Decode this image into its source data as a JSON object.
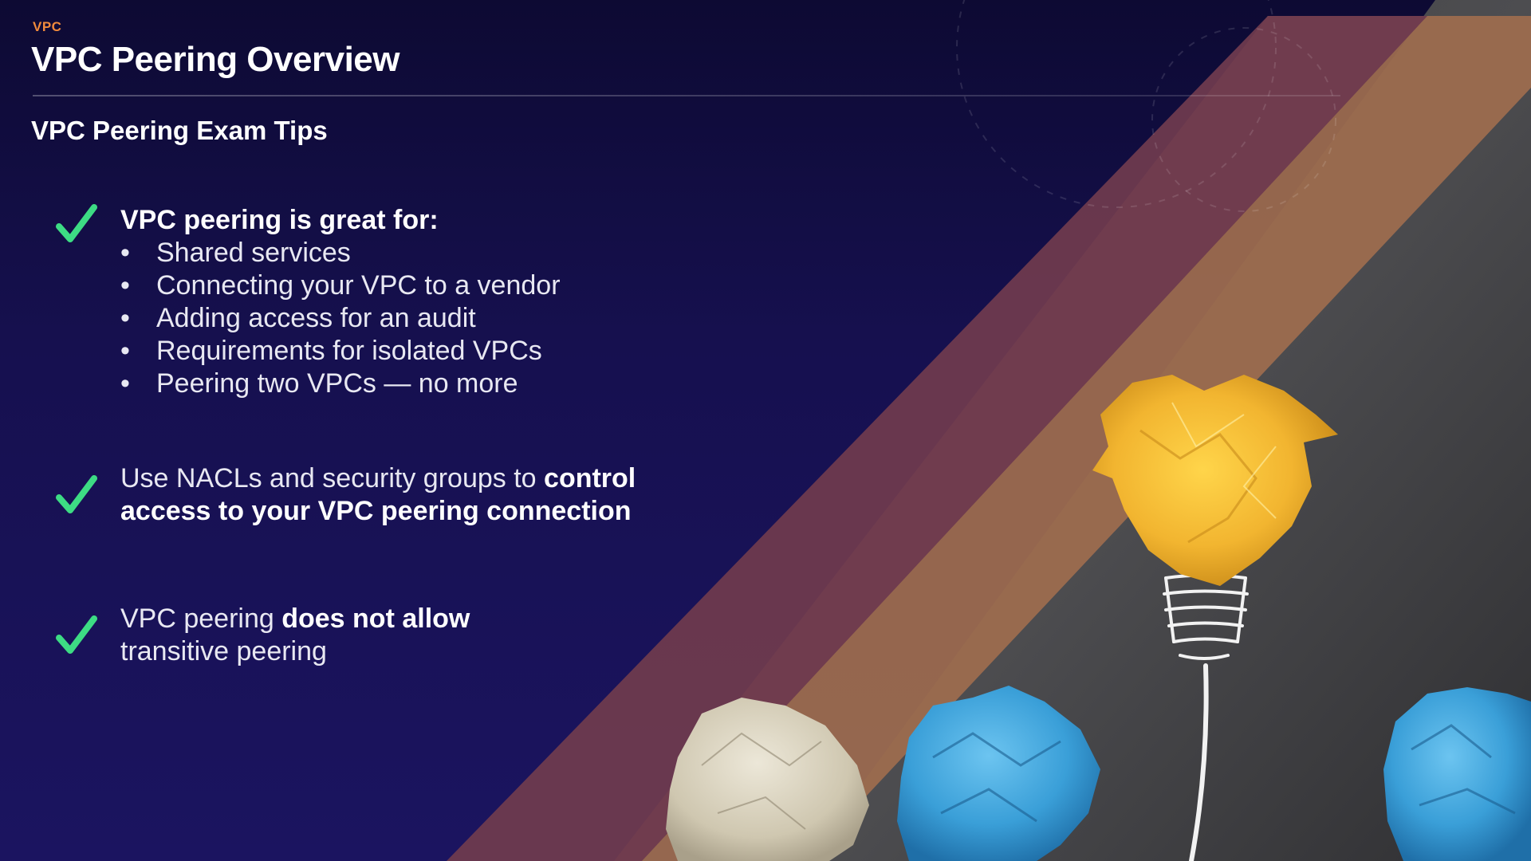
{
  "header": {
    "section_label": "VPC",
    "title": "VPC Peering Overview"
  },
  "subtitle": "VPC Peering Exam Tips",
  "tips": [
    {
      "heading": "VPC peering is great for:",
      "bullets": [
        "Shared services",
        "Connecting your VPC to a vendor",
        "Adding access for an audit",
        "Requirements for isolated VPCs",
        "Peering two VPCs — no more"
      ]
    },
    {
      "text_prefix": "Use NACLs and security groups to ",
      "text_bold": "control access to your VPC peering connection"
    },
    {
      "text_prefix": "VPC peering ",
      "text_bold": "does not allow",
      "text_suffix": " transitive peering"
    }
  ],
  "icons": {
    "check": "check-icon"
  },
  "colors": {
    "background": "#16104f",
    "accent_orange": "#f08a3c",
    "check_green": "#3ddc84",
    "stripe_maroon": "#6e3a4e",
    "stripe_tan": "#9c6b4e",
    "chalkboard": "#4a4a4c",
    "paper_yellow": "#f2b530",
    "paper_blue": "#3a9fd8",
    "paper_beige": "#d8d2c0"
  }
}
